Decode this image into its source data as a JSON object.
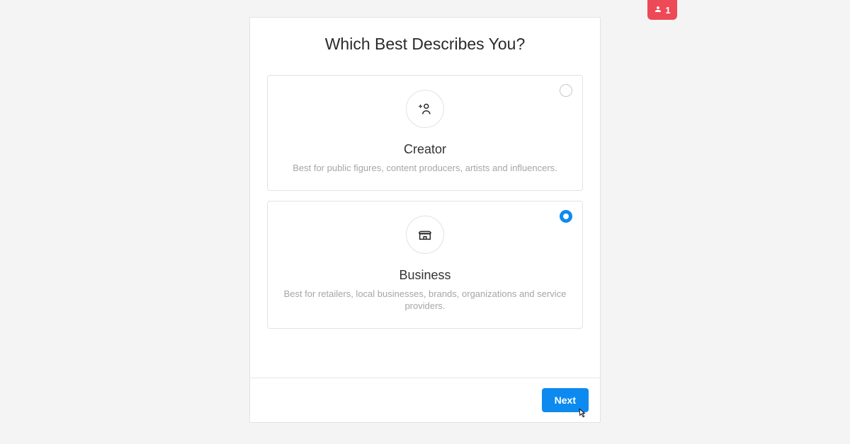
{
  "badge": {
    "count": "1"
  },
  "modal": {
    "title": "Which Best Describes You?",
    "options": [
      {
        "title": "Creator",
        "description": "Best for public figures, content producers, artists and influencers.",
        "selected": false
      },
      {
        "title": "Business",
        "description": "Best for retailers, local businesses, brands, organizations and service providers.",
        "selected": true
      }
    ],
    "next_label": "Next"
  },
  "colors": {
    "accent": "#0d8af0",
    "badge_bg": "#ed4956"
  }
}
